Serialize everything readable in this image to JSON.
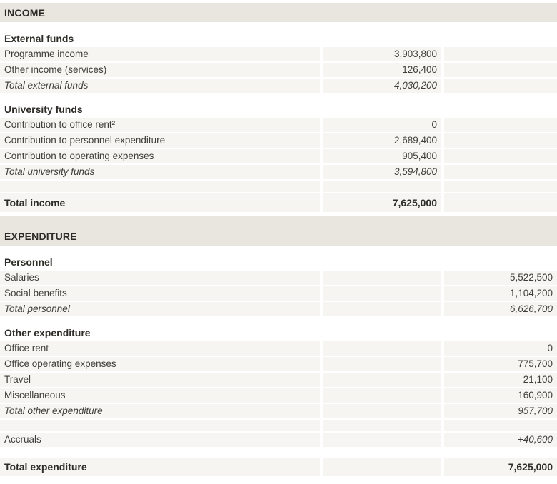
{
  "colors": {
    "section_band_bg": "#e9e6e0",
    "row_bg": "#f6f5f2",
    "text": "#403e3a",
    "bold_text": "#2f2d29"
  },
  "income": {
    "section_title": "INCOME",
    "groups": [
      {
        "header": "External funds",
        "rows": [
          {
            "label": "Programme income",
            "value": "3,903,800"
          },
          {
            "label": "Other income (services)",
            "value": "126,400"
          }
        ],
        "total_row": {
          "label": "Total external funds",
          "value": "4,030,200"
        }
      },
      {
        "header": "University funds",
        "rows": [
          {
            "label": "Contribution to office rent²",
            "value": "0"
          },
          {
            "label": "Contribution to personnel expenditure",
            "value": "2,689,400"
          },
          {
            "label": "Contribution to operating expenses",
            "value": "905,400"
          }
        ],
        "total_row": {
          "label": "Total university funds",
          "value": "3,594,800"
        }
      }
    ],
    "total": {
      "label": "Total income",
      "value": "7,625,000"
    }
  },
  "expenditure": {
    "section_title": "EXPENDITURE",
    "groups": [
      {
        "header": "Personnel",
        "rows": [
          {
            "label": "Salaries",
            "value": "5,522,500"
          },
          {
            "label": "Social benefits",
            "value": "1,104,200"
          }
        ],
        "total_row": {
          "label": "Total personnel",
          "value": "6,626,700"
        }
      },
      {
        "header": "Other expenditure",
        "rows": [
          {
            "label": "Office rent",
            "value": "0"
          },
          {
            "label": "Office operating expenses",
            "value": "775,700"
          },
          {
            "label": "Travel",
            "value": "21,100"
          },
          {
            "label": "Miscellaneous",
            "value": "160,900"
          }
        ],
        "total_row": {
          "label": "Total other expenditure",
          "value": "957,700"
        }
      }
    ],
    "accruals": {
      "label": "Accruals",
      "value": "+40,600"
    },
    "total": {
      "label": "Total expenditure",
      "value": "7,625,000"
    }
  }
}
